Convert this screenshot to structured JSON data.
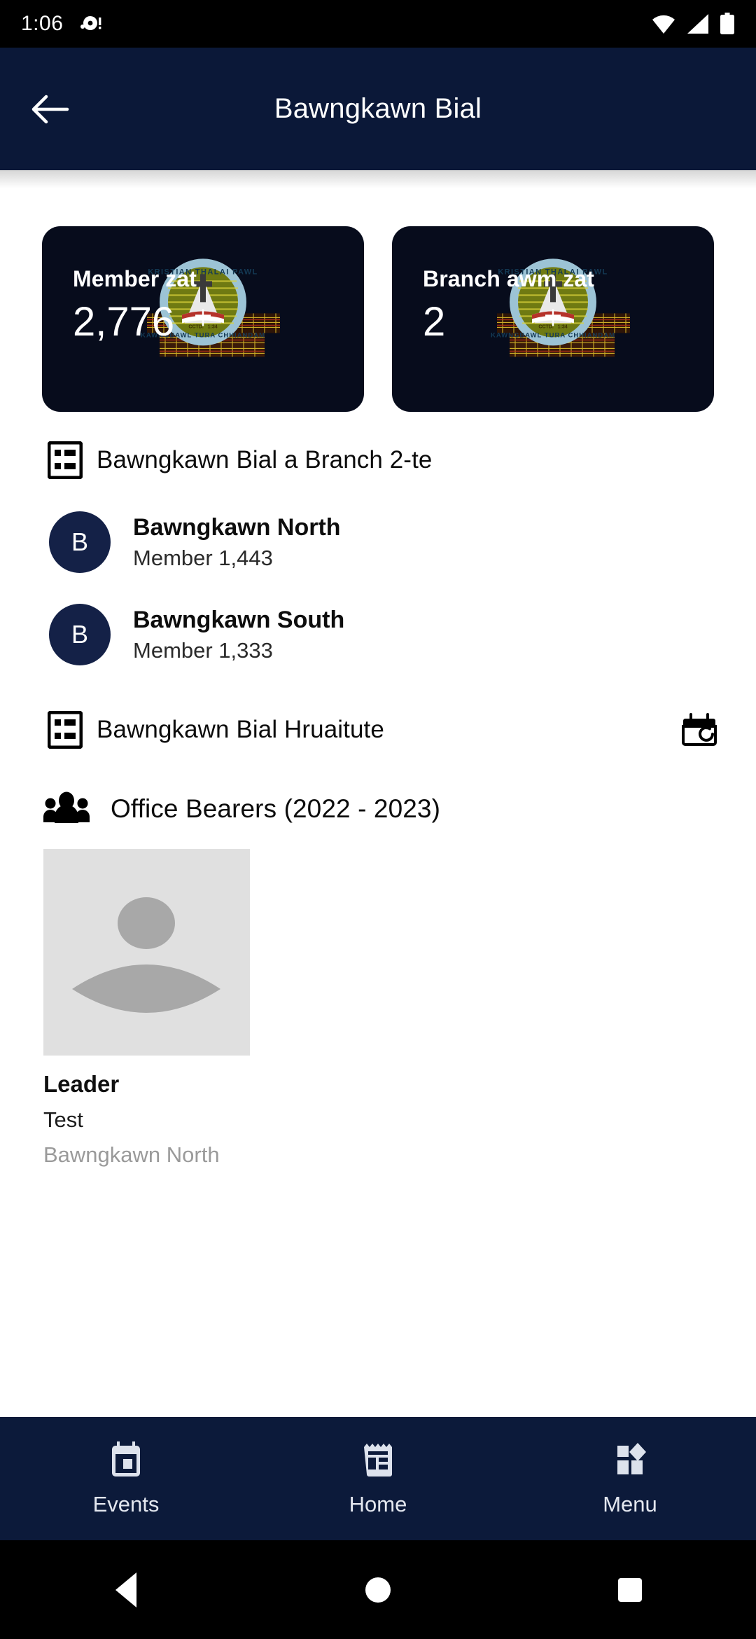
{
  "status_bar": {
    "clock": "1:06",
    "left_icons": [
      "notification-dot-icon"
    ],
    "right_icons": [
      "wifi-icon",
      "cellular-signal-icon",
      "battery-icon"
    ]
  },
  "app_bar": {
    "back_icon": "arrow-left-icon",
    "title": "Bawngkawn Bial"
  },
  "stats": [
    {
      "label": "Member zat",
      "value": "2,776",
      "watermark": "kristian-thalai-pawl-emblem"
    },
    {
      "label": "Branch awm zat",
      "value": "2",
      "watermark": "kristian-thalai-pawl-emblem"
    }
  ],
  "branch_section": {
    "icon": "list-icon",
    "title": "Bawngkawn Bial a Branch 2-te",
    "items": [
      {
        "initial": "B",
        "name": "Bawngkawn North",
        "members": "Member 1,443"
      },
      {
        "initial": "B",
        "name": "Bawngkawn South",
        "members": "Member 1,333"
      }
    ]
  },
  "leaders_section": {
    "icon": "list-icon",
    "title": "Bawngkawn Bial Hruaitute",
    "action_icon": "calendar-history-icon"
  },
  "office_bearers": {
    "icon": "people-group-icon",
    "title": "Office Bearers (2022 - 2023)",
    "cards": [
      {
        "photo": "person-placeholder-avatar",
        "role": "Leader",
        "name": "Test",
        "branch": "Bawngkawn North"
      }
    ]
  },
  "bottom_nav": {
    "items": [
      {
        "icon": "calendar-events-icon",
        "label": "Events"
      },
      {
        "icon": "dashboard-home-icon",
        "label": "Home"
      },
      {
        "icon": "apps-menu-icon",
        "label": "Menu"
      }
    ]
  },
  "android_nav": {
    "back": "triangle-back-icon",
    "home": "circle-home-icon",
    "recents": "square-recents-icon"
  },
  "colors": {
    "app_bar": "#0B1838",
    "card_bg": "#070C1C",
    "bottom_nav": "#0C1A3A",
    "avatar_bg": "#142147",
    "page_bg": "#FFFFFF",
    "nav_label": "#E3E7EF"
  }
}
